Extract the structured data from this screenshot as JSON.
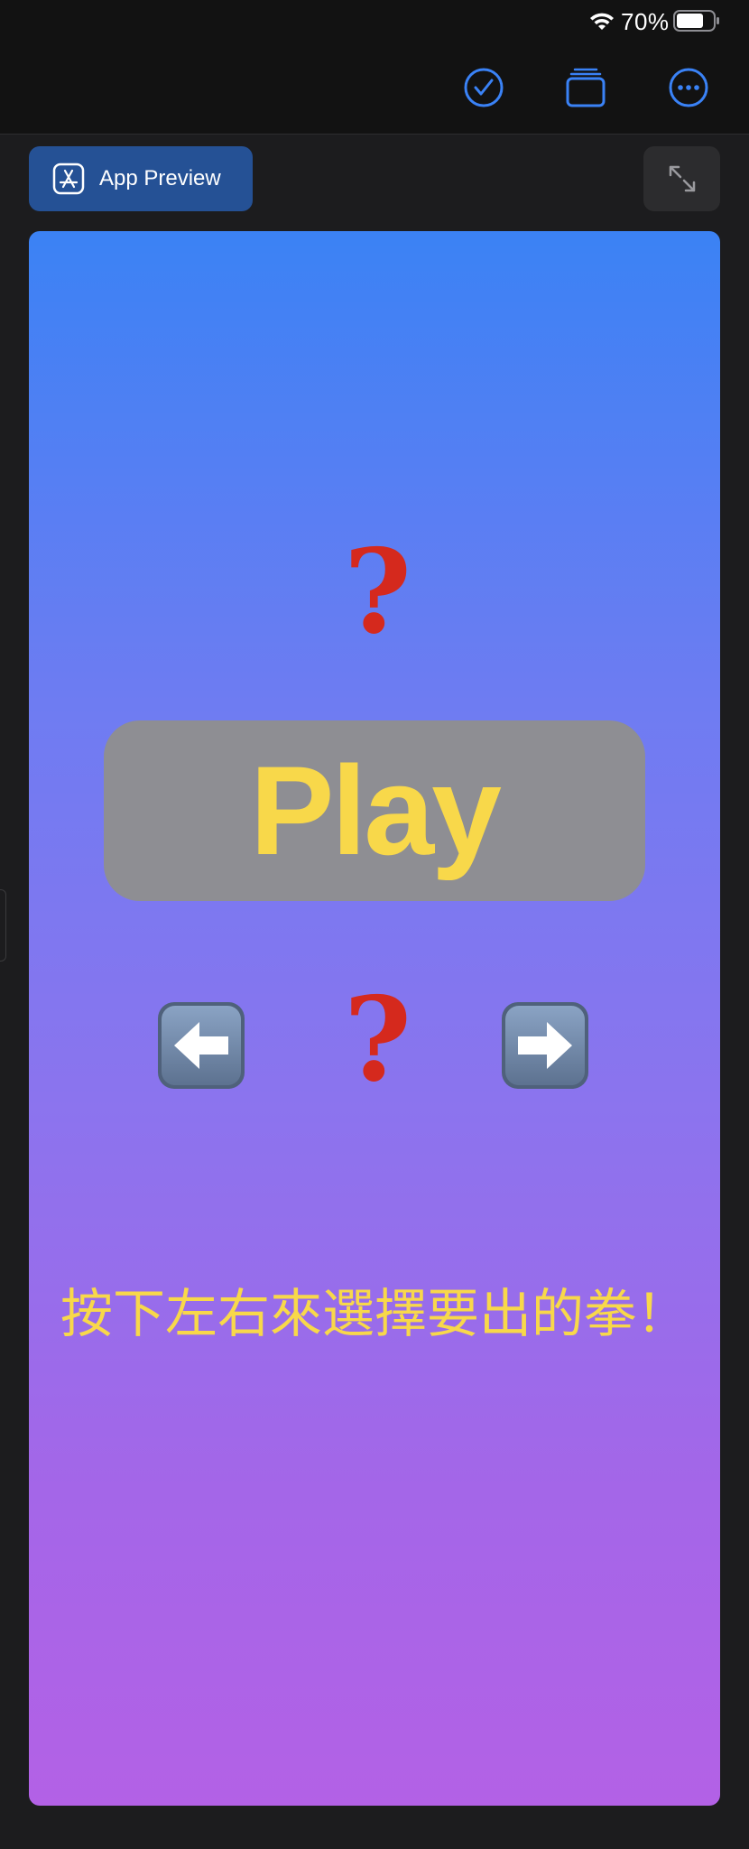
{
  "status_bar": {
    "battery_percent": "70%"
  },
  "toolbar": {
    "icons": [
      "checkmark-circle-icon",
      "stack-icon",
      "more-options-icon"
    ],
    "accent_color": "#3a82f6"
  },
  "header": {
    "app_preview_label": "App Preview"
  },
  "preview": {
    "top_result": "?",
    "play_label": "Play",
    "middle_result": "?",
    "left_arrow": "⬅",
    "right_arrow": "➡",
    "hint": "按下左右來選擇要出的拳！",
    "gradient_top": "#3b82f4",
    "gradient_bottom": "#b361e6",
    "text_color": "#f8d84a",
    "question_color": "#d5291d"
  }
}
